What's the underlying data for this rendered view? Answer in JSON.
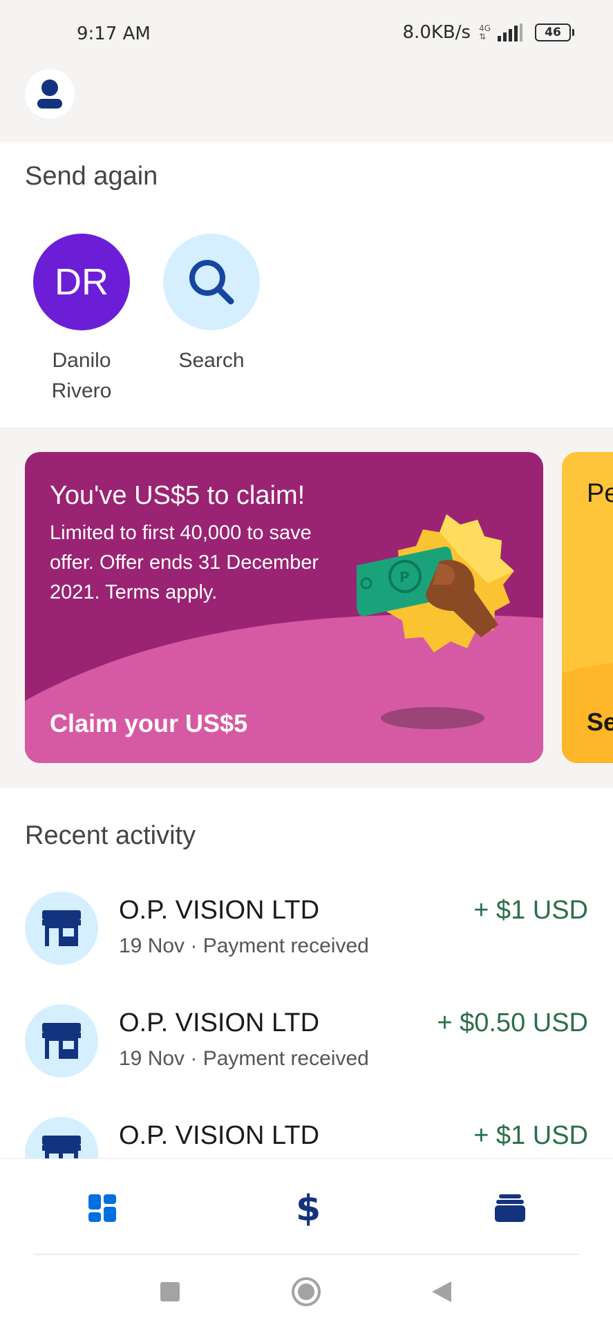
{
  "status_bar": {
    "time": "9:17 AM",
    "net_speed": "8.0KB/s",
    "network_type": "4G",
    "battery": "46"
  },
  "header": {
    "avatar_icon": "profile-icon"
  },
  "send_again": {
    "title": "Send again",
    "contacts": [
      {
        "initials": "DR",
        "name_line1": "Danilo",
        "name_line2": "Rivero"
      },
      {
        "icon": "search-icon",
        "label": "Search"
      }
    ]
  },
  "promos": [
    {
      "title": "You've US$5 to claim!",
      "body": "Limited to first 40,000 to save offer. Offer ends 31 December 2021. Terms apply.",
      "cta": "Claim your US$5"
    },
    {
      "text_partial": "Pe wi en",
      "cta_partial": "Se"
    }
  ],
  "recent_activity": {
    "title": "Recent activity",
    "items": [
      {
        "name": "O.P. VISION LTD",
        "meta": "19 Nov · Payment received",
        "amount": "+ $1 USD"
      },
      {
        "name": "O.P. VISION LTD",
        "meta": "19 Nov · Payment received",
        "amount": "+ $0.50 USD"
      },
      {
        "name": "O.P. VISION LTD",
        "meta": "",
        "amount": "+ $1 USD"
      }
    ]
  },
  "bottom_nav": {
    "items": [
      {
        "icon": "dashboard-icon"
      },
      {
        "icon": "dollar-icon"
      },
      {
        "icon": "wallet-icon"
      }
    ]
  },
  "colors": {
    "brand_blue": "#1546a0",
    "accent_blue": "#0070e0",
    "promo_purple": "#9a2373",
    "promo_pink": "#d65aa3",
    "promo_yellow": "#ffc53a",
    "amount_green": "#2c6e49",
    "avatar_purple": "#6c1ed7"
  }
}
